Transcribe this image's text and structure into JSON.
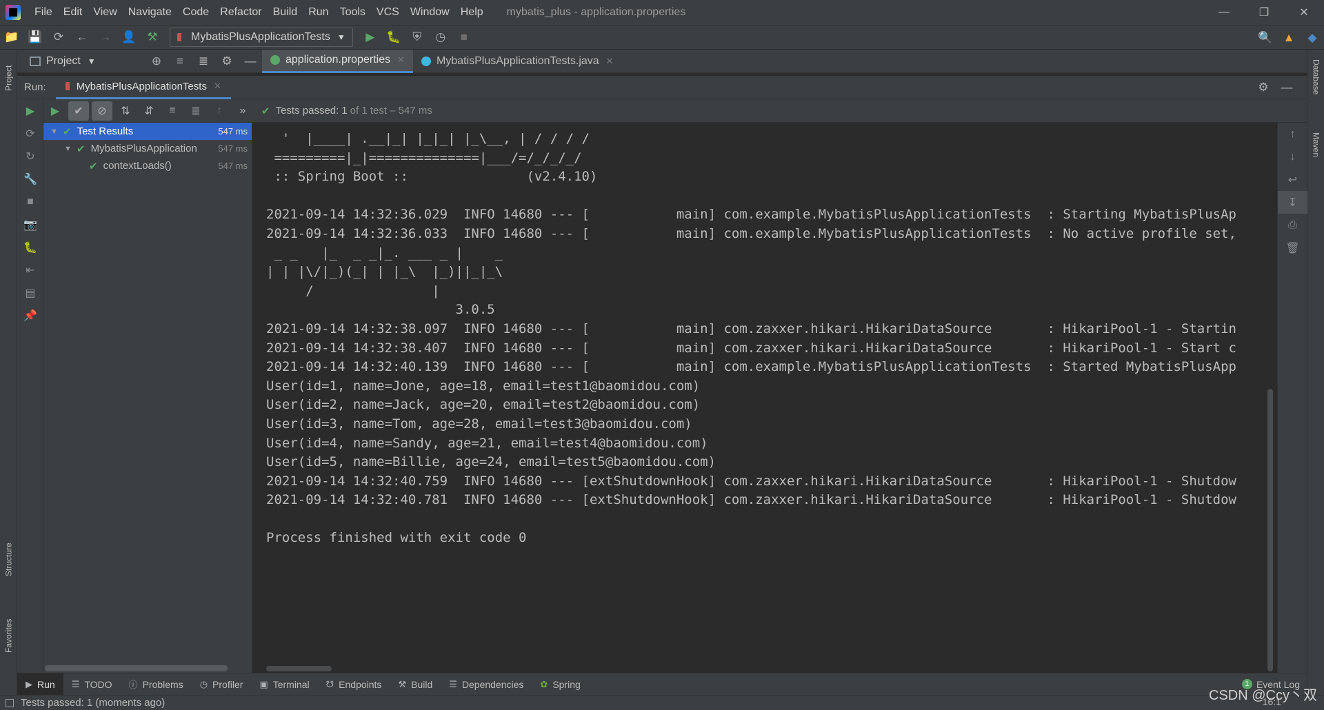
{
  "window": {
    "title": "mybatis_plus - application.properties",
    "menu": [
      "File",
      "Edit",
      "View",
      "Navigate",
      "Code",
      "Refactor",
      "Build",
      "Run",
      "Tools",
      "VCS",
      "Window",
      "Help"
    ]
  },
  "toolbar": {
    "run_config": "MybatisPlusApplicationTests"
  },
  "side_tabs": {
    "project": "Project",
    "structure": "Structure",
    "favorites": "Favorites",
    "database": "Database",
    "maven": "Maven"
  },
  "project_panel": {
    "label": "Project"
  },
  "editor_tabs": [
    {
      "label": "application.properties",
      "active": true
    },
    {
      "label": "MybatisPlusApplicationTests.java",
      "active": false
    }
  ],
  "run_panel": {
    "label": "Run:",
    "tab": "MybatisPlusApplicationTests",
    "status": "Tests passed:",
    "status_count": "1",
    "status_detail": "of 1 test – 547 ms"
  },
  "test_tree": [
    {
      "label": "Test Results",
      "time": "547 ms",
      "level": 0
    },
    {
      "label": "MybatisPlusApplication",
      "time": "547 ms",
      "level": 1
    },
    {
      "label": "contextLoads()",
      "time": "547 ms",
      "level": 2
    }
  ],
  "console": [
    "  '  |____| .__|_| |_|_| |_\\__, | / / / /",
    " =========|_|==============|___/=/_/_/_/",
    " :: Spring Boot ::               (v2.4.10)",
    "",
    "2021-09-14 14:32:36.029  INFO 14680 --- [           main] com.example.MybatisPlusApplicationTests  : Starting MybatisPlusAp",
    "2021-09-14 14:32:36.033  INFO 14680 --- [           main] com.example.MybatisPlusApplicationTests  : No active profile set,",
    " _ _   |_  _ _|_. ___ _ |    _",
    "| | |\\/|_)(_| | |_\\  |_)||_|_\\",
    "     /               |",
    "                        3.0.5",
    "2021-09-14 14:32:38.097  INFO 14680 --- [           main] com.zaxxer.hikari.HikariDataSource       : HikariPool-1 - Startin",
    "2021-09-14 14:32:38.407  INFO 14680 --- [           main] com.zaxxer.hikari.HikariDataSource       : HikariPool-1 - Start c",
    "2021-09-14 14:32:40.139  INFO 14680 --- [           main] com.example.MybatisPlusApplicationTests  : Started MybatisPlusApp",
    "User(id=1, name=Jone, age=18, email=test1@baomidou.com)",
    "User(id=2, name=Jack, age=20, email=test2@baomidou.com)",
    "User(id=3, name=Tom, age=28, email=test3@baomidou.com)",
    "User(id=4, name=Sandy, age=21, email=test4@baomidou.com)",
    "User(id=5, name=Billie, age=24, email=test5@baomidou.com)",
    "2021-09-14 14:32:40.759  INFO 14680 --- [extShutdownHook] com.zaxxer.hikari.HikariDataSource       : HikariPool-1 - Shutdow",
    "2021-09-14 14:32:40.781  INFO 14680 --- [extShutdownHook] com.zaxxer.hikari.HikariDataSource       : HikariPool-1 - Shutdow",
    "",
    "Process finished with exit code 0"
  ],
  "bottom_tabs": [
    "Run",
    "TODO",
    "Problems",
    "Profiler",
    "Terminal",
    "Endpoints",
    "Build",
    "Dependencies",
    "Spring"
  ],
  "event_log": {
    "label": "Event Log",
    "count": "1"
  },
  "status_bar": {
    "message": "Tests passed: 1 (moments ago)",
    "position": "16:1"
  },
  "watermark": "CSDN @Ccy丶双",
  "colors": {
    "accent": "#4a88c7",
    "selection": "#2f65ca",
    "success": "#59a869",
    "background": "#2b2b2b",
    "panel": "#3c3f41"
  }
}
